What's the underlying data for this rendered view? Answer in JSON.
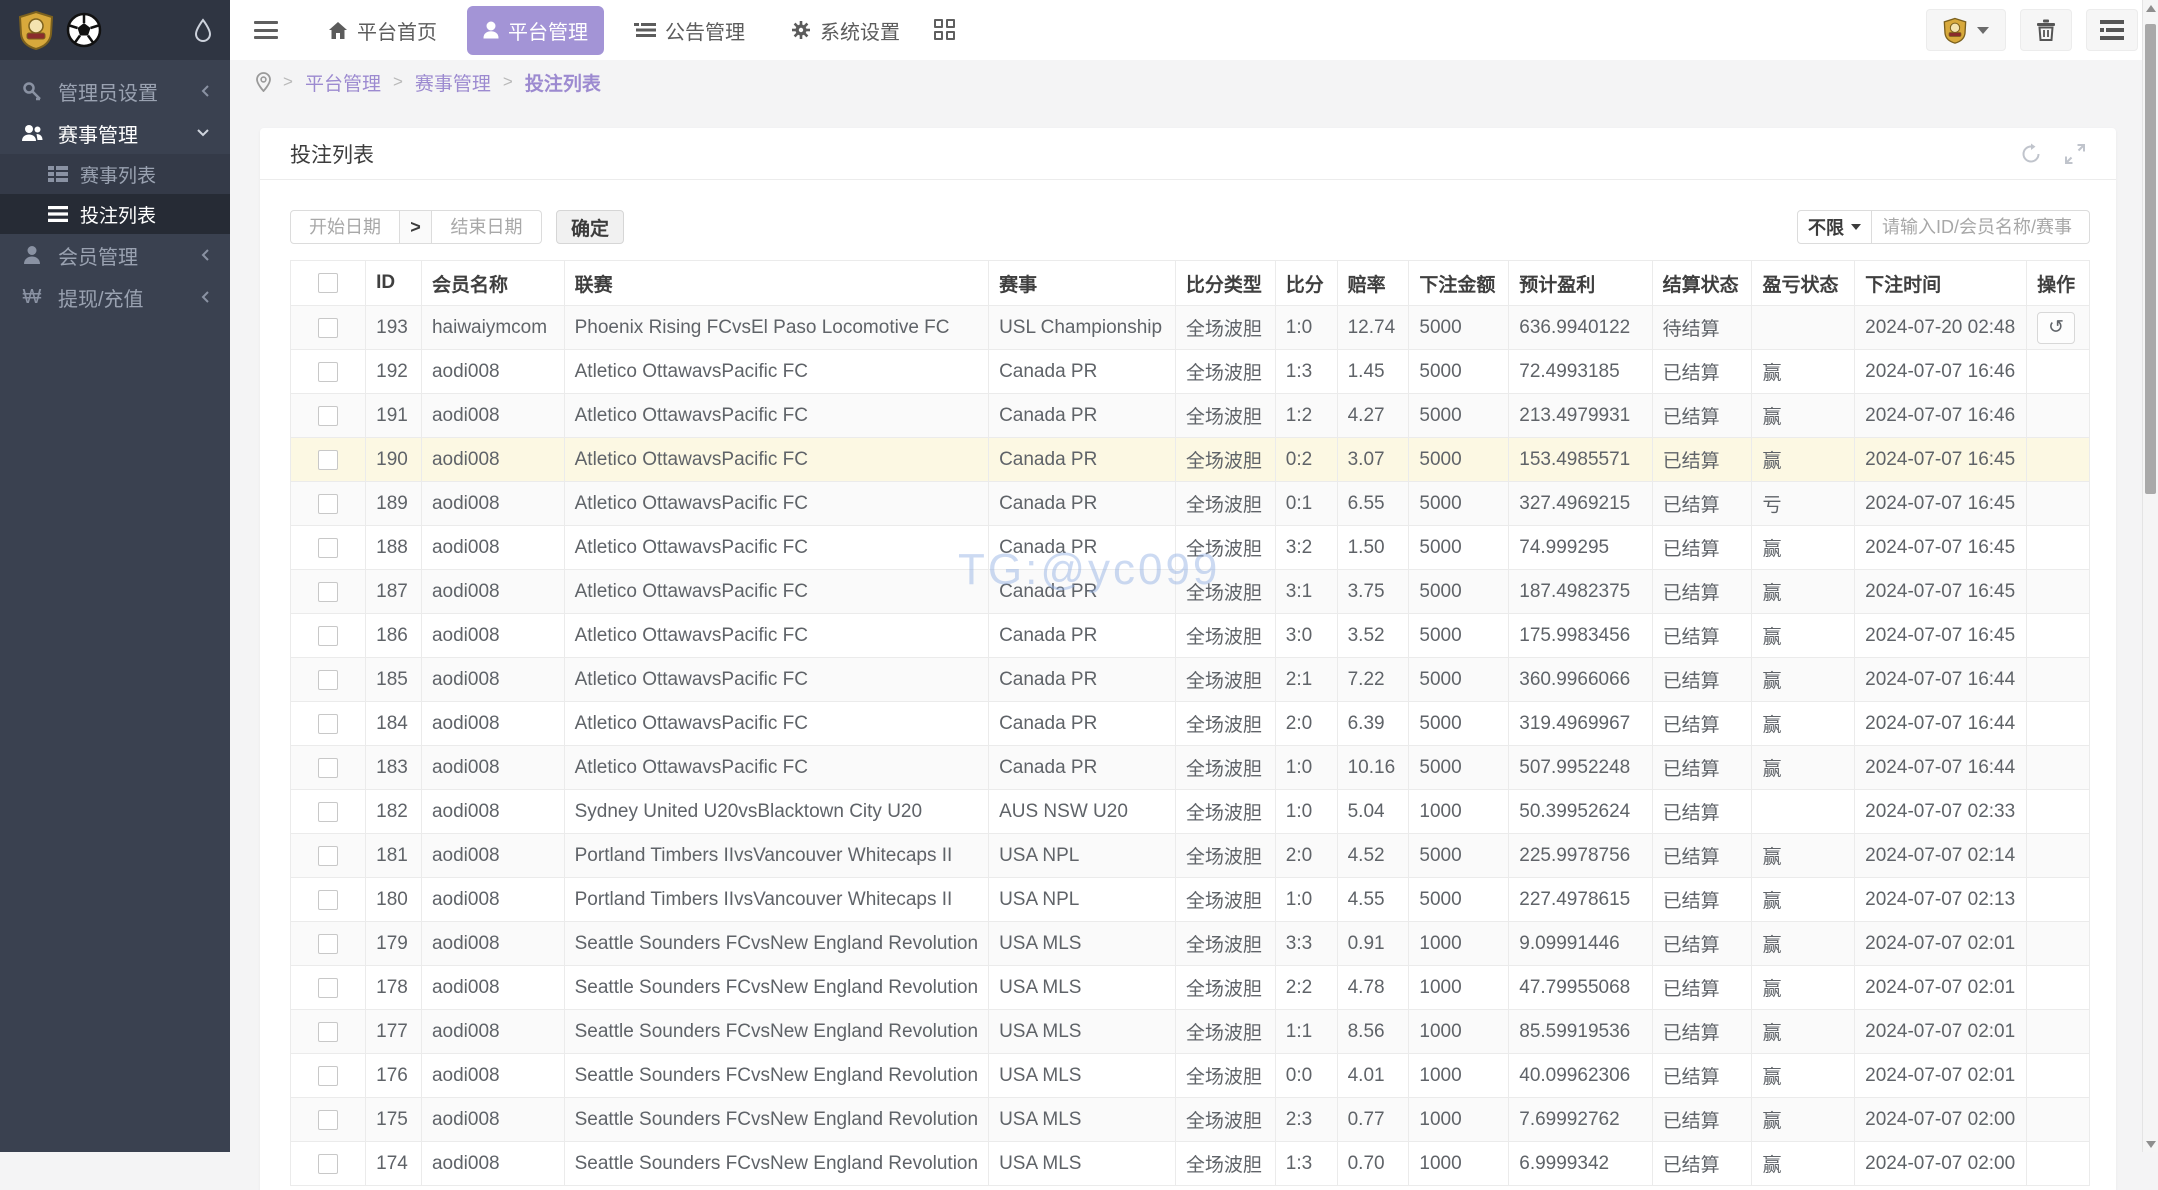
{
  "topbar": {
    "nav": [
      {
        "label": "平台首页"
      },
      {
        "label": "平台管理"
      },
      {
        "label": "公告管理"
      },
      {
        "label": "系统设置"
      }
    ]
  },
  "sidebar": {
    "items": [
      {
        "label": "管理员设置"
      },
      {
        "label": "赛事管理",
        "children": [
          {
            "label": "赛事列表"
          },
          {
            "label": "投注列表"
          }
        ]
      },
      {
        "label": "会员管理"
      },
      {
        "label": "提现/充值"
      }
    ],
    "won_glyph": "₩"
  },
  "breadcrumb": {
    "items": [
      "平台管理",
      "赛事管理",
      "投注列表"
    ],
    "separator": ">"
  },
  "panel": {
    "title": "投注列表"
  },
  "filters": {
    "start_date_placeholder": "开始日期",
    "range_arrow": ">",
    "end_date_placeholder": "结束日期",
    "confirm_label": "确定",
    "scope_label": "不限",
    "search_placeholder": "请输入ID/会员名称/赛事"
  },
  "watermark": "TG:@yc099",
  "table": {
    "headers": [
      "",
      "ID",
      "会员名称",
      "联赛",
      "赛事",
      "比分类型",
      "比分",
      "赔率",
      "下注金额",
      "预计盈利",
      "结算状态",
      "盈亏状态",
      "下注时间",
      "操作"
    ],
    "action_glyph": "↺",
    "rows": [
      {
        "id": "193",
        "member": "haiwaiymcom",
        "league": "Phoenix Rising FCvsEl Paso Locomotive FC",
        "match": "USL Championship",
        "score_type": "全场波胆",
        "score": "1:0",
        "odds": "12.74",
        "amount": "5000",
        "profit": "636.9940122",
        "settle": "待结算",
        "result": "",
        "time": "2024-07-20 02:48",
        "action": true,
        "highlight": false
      },
      {
        "id": "192",
        "member": "aodi008",
        "league": "Atletico OttawavsPacific FC",
        "match": "Canada PR",
        "score_type": "全场波胆",
        "score": "1:3",
        "odds": "1.45",
        "amount": "5000",
        "profit": "72.4993185",
        "settle": "已结算",
        "result": "赢",
        "time": "2024-07-07 16:46",
        "action": false,
        "highlight": false
      },
      {
        "id": "191",
        "member": "aodi008",
        "league": "Atletico OttawavsPacific FC",
        "match": "Canada PR",
        "score_type": "全场波胆",
        "score": "1:2",
        "odds": "4.27",
        "amount": "5000",
        "profit": "213.4979931",
        "settle": "已结算",
        "result": "赢",
        "time": "2024-07-07 16:46",
        "action": false,
        "highlight": false
      },
      {
        "id": "190",
        "member": "aodi008",
        "league": "Atletico OttawavsPacific FC",
        "match": "Canada PR",
        "score_type": "全场波胆",
        "score": "0:2",
        "odds": "3.07",
        "amount": "5000",
        "profit": "153.4985571",
        "settle": "已结算",
        "result": "赢",
        "time": "2024-07-07 16:45",
        "action": false,
        "highlight": true
      },
      {
        "id": "189",
        "member": "aodi008",
        "league": "Atletico OttawavsPacific FC",
        "match": "Canada PR",
        "score_type": "全场波胆",
        "score": "0:1",
        "odds": "6.55",
        "amount": "5000",
        "profit": "327.4969215",
        "settle": "已结算",
        "result": "亏",
        "time": "2024-07-07 16:45",
        "action": false,
        "highlight": false
      },
      {
        "id": "188",
        "member": "aodi008",
        "league": "Atletico OttawavsPacific FC",
        "match": "Canada PR",
        "score_type": "全场波胆",
        "score": "3:2",
        "odds": "1.50",
        "amount": "5000",
        "profit": "74.999295",
        "settle": "已结算",
        "result": "赢",
        "time": "2024-07-07 16:45",
        "action": false,
        "highlight": false
      },
      {
        "id": "187",
        "member": "aodi008",
        "league": "Atletico OttawavsPacific FC",
        "match": "Canada PR",
        "score_type": "全场波胆",
        "score": "3:1",
        "odds": "3.75",
        "amount": "5000",
        "profit": "187.4982375",
        "settle": "已结算",
        "result": "赢",
        "time": "2024-07-07 16:45",
        "action": false,
        "highlight": false
      },
      {
        "id": "186",
        "member": "aodi008",
        "league": "Atletico OttawavsPacific FC",
        "match": "Canada PR",
        "score_type": "全场波胆",
        "score": "3:0",
        "odds": "3.52",
        "amount": "5000",
        "profit": "175.9983456",
        "settle": "已结算",
        "result": "赢",
        "time": "2024-07-07 16:45",
        "action": false,
        "highlight": false
      },
      {
        "id": "185",
        "member": "aodi008",
        "league": "Atletico OttawavsPacific FC",
        "match": "Canada PR",
        "score_type": "全场波胆",
        "score": "2:1",
        "odds": "7.22",
        "amount": "5000",
        "profit": "360.9966066",
        "settle": "已结算",
        "result": "赢",
        "time": "2024-07-07 16:44",
        "action": false,
        "highlight": false
      },
      {
        "id": "184",
        "member": "aodi008",
        "league": "Atletico OttawavsPacific FC",
        "match": "Canada PR",
        "score_type": "全场波胆",
        "score": "2:0",
        "odds": "6.39",
        "amount": "5000",
        "profit": "319.4969967",
        "settle": "已结算",
        "result": "赢",
        "time": "2024-07-07 16:44",
        "action": false,
        "highlight": false
      },
      {
        "id": "183",
        "member": "aodi008",
        "league": "Atletico OttawavsPacific FC",
        "match": "Canada PR",
        "score_type": "全场波胆",
        "score": "1:0",
        "odds": "10.16",
        "amount": "5000",
        "profit": "507.9952248",
        "settle": "已结算",
        "result": "赢",
        "time": "2024-07-07 16:44",
        "action": false,
        "highlight": false
      },
      {
        "id": "182",
        "member": "aodi008",
        "league": "Sydney United U20vsBlacktown City U20",
        "match": "AUS NSW U20",
        "score_type": "全场波胆",
        "score": "1:0",
        "odds": "5.04",
        "amount": "1000",
        "profit": "50.39952624",
        "settle": "已结算",
        "result": "",
        "time": "2024-07-07 02:33",
        "action": false,
        "highlight": false
      },
      {
        "id": "181",
        "member": "aodi008",
        "league": "Portland Timbers IIvsVancouver Whitecaps II",
        "match": "USA NPL",
        "score_type": "全场波胆",
        "score": "2:0",
        "odds": "4.52",
        "amount": "5000",
        "profit": "225.9978756",
        "settle": "已结算",
        "result": "赢",
        "time": "2024-07-07 02:14",
        "action": false,
        "highlight": false
      },
      {
        "id": "180",
        "member": "aodi008",
        "league": "Portland Timbers IIvsVancouver Whitecaps II",
        "match": "USA NPL",
        "score_type": "全场波胆",
        "score": "1:0",
        "odds": "4.55",
        "amount": "5000",
        "profit": "227.4978615",
        "settle": "已结算",
        "result": "赢",
        "time": "2024-07-07 02:13",
        "action": false,
        "highlight": false
      },
      {
        "id": "179",
        "member": "aodi008",
        "league": "Seattle Sounders FCvsNew England Revolution",
        "match": "USA MLS",
        "score_type": "全场波胆",
        "score": "3:3",
        "odds": "0.91",
        "amount": "1000",
        "profit": "9.09991446",
        "settle": "已结算",
        "result": "赢",
        "time": "2024-07-07 02:01",
        "action": false,
        "highlight": false
      },
      {
        "id": "178",
        "member": "aodi008",
        "league": "Seattle Sounders FCvsNew England Revolution",
        "match": "USA MLS",
        "score_type": "全场波胆",
        "score": "2:2",
        "odds": "4.78",
        "amount": "1000",
        "profit": "47.79955068",
        "settle": "已结算",
        "result": "赢",
        "time": "2024-07-07 02:01",
        "action": false,
        "highlight": false
      },
      {
        "id": "177",
        "member": "aodi008",
        "league": "Seattle Sounders FCvsNew England Revolution",
        "match": "USA MLS",
        "score_type": "全场波胆",
        "score": "1:1",
        "odds": "8.56",
        "amount": "1000",
        "profit": "85.59919536",
        "settle": "已结算",
        "result": "赢",
        "time": "2024-07-07 02:01",
        "action": false,
        "highlight": false
      },
      {
        "id": "176",
        "member": "aodi008",
        "league": "Seattle Sounders FCvsNew England Revolution",
        "match": "USA MLS",
        "score_type": "全场波胆",
        "score": "0:0",
        "odds": "4.01",
        "amount": "1000",
        "profit": "40.09962306",
        "settle": "已结算",
        "result": "赢",
        "time": "2024-07-07 02:01",
        "action": false,
        "highlight": false
      },
      {
        "id": "175",
        "member": "aodi008",
        "league": "Seattle Sounders FCvsNew England Revolution",
        "match": "USA MLS",
        "score_type": "全场波胆",
        "score": "2:3",
        "odds": "0.77",
        "amount": "1000",
        "profit": "7.69992762",
        "settle": "已结算",
        "result": "赢",
        "time": "2024-07-07 02:00",
        "action": false,
        "highlight": false
      },
      {
        "id": "174",
        "member": "aodi008",
        "league": "Seattle Sounders FCvsNew England Revolution",
        "match": "USA MLS",
        "score_type": "全场波胆",
        "score": "1:3",
        "odds": "0.70",
        "amount": "1000",
        "profit": "6.9999342",
        "settle": "已结算",
        "result": "赢",
        "time": "2024-07-07 02:00",
        "action": false,
        "highlight": false
      }
    ]
  }
}
